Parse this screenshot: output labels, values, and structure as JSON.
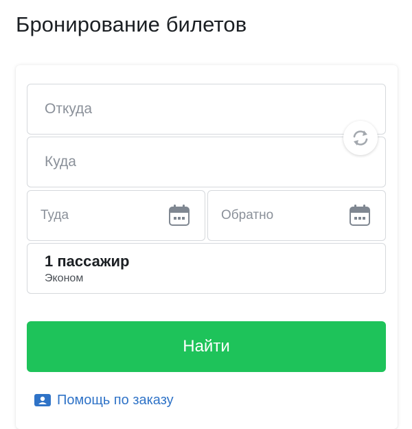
{
  "page": {
    "title": "Бронирование билетов"
  },
  "form": {
    "from_placeholder": "Откуда",
    "to_placeholder": "Куда",
    "date_there_placeholder": "Туда",
    "date_back_placeholder": "Обратно",
    "passengers": {
      "count_label": "1 пассажир",
      "class_label": "Эконом"
    },
    "search_label": "Найти"
  },
  "help": {
    "label": "Помощь по заказу"
  },
  "colors": {
    "accent_green": "#1ec35a",
    "link_blue": "#2f73c7",
    "border": "#d5d8dc",
    "placeholder": "#8a9099"
  },
  "icons": {
    "swap": "swap-arrows-icon",
    "calendar": "calendar-icon",
    "help": "contact-card-icon"
  }
}
